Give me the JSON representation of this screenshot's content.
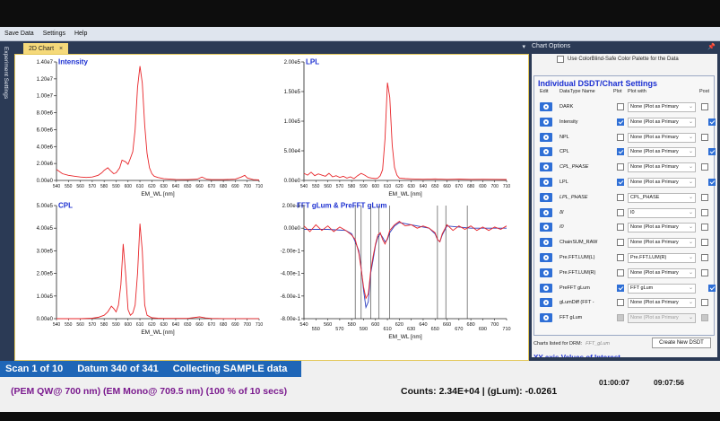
{
  "menu": [
    "Save Data",
    "Settings",
    "Help"
  ],
  "left_strip_label": "Experiment Settings",
  "tab": {
    "label": "2D Chart",
    "close": "×",
    "dropdown": "▾"
  },
  "right_panel": {
    "title": "Chart Options",
    "pin": "📌",
    "palette_label": "Use ColorBlind-Safe Color Palette for the Data",
    "section_title": "Individual DSDT/Chart Settings",
    "columns": [
      "Edit",
      "DataType Name",
      "Plot",
      "Plot with",
      "Post"
    ],
    "rows": [
      {
        "name": "DARK",
        "italic": false,
        "plot": false,
        "plot_with": "None (Plot as Primary",
        "disabled_select": false,
        "post": false
      },
      {
        "name": "Intensity",
        "italic": false,
        "plot": true,
        "plot_with": "None (Plot as Primary",
        "disabled_select": false,
        "post": true
      },
      {
        "name": "NPL",
        "italic": false,
        "plot": false,
        "plot_with": "None (Plot as Primary",
        "disabled_select": false,
        "post": false
      },
      {
        "name": "CPL",
        "italic": false,
        "plot": true,
        "plot_with": "None (Plot as Primary",
        "disabled_select": false,
        "post": true
      },
      {
        "name": "CPL_PHASE",
        "italic": true,
        "plot": false,
        "plot_with": "None (Plot as Primary",
        "disabled_select": false,
        "post": false
      },
      {
        "name": "LPL",
        "italic": false,
        "plot": true,
        "plot_with": "None (Plot as Primary",
        "disabled_select": false,
        "post": true
      },
      {
        "name": "LPL_PHASE",
        "italic": true,
        "plot": false,
        "plot_with": "CPL_PHASE",
        "disabled_select": false,
        "post": false
      },
      {
        "name": "δI",
        "italic": true,
        "plot": false,
        "plot_with": "I0",
        "disabled_select": false,
        "post": false
      },
      {
        "name": "I0",
        "italic": true,
        "plot": false,
        "plot_with": "None (Plot as Primary",
        "disabled_select": false,
        "post": false
      },
      {
        "name": "ChainSUM_RAW",
        "italic": false,
        "plot": false,
        "plot_with": "None (Plot as Primary",
        "disabled_select": false,
        "post": false
      },
      {
        "name": "Pre.FFT.LUM(L)",
        "italic": false,
        "plot": false,
        "plot_with": "Pre.FFT.LUM(R)",
        "disabled_select": false,
        "post": false
      },
      {
        "name": "Pre.FFT.LUM(R)",
        "italic": false,
        "plot": false,
        "plot_with": "None (Plot as Primary",
        "disabled_select": false,
        "post": false
      },
      {
        "name": "PreFFT gLum",
        "italic": false,
        "plot": true,
        "plot_with": "FFT gLum",
        "disabled_select": false,
        "post": true
      },
      {
        "name": "gLumDiff (FFT -",
        "italic": false,
        "plot": false,
        "plot_with": "None (Plot as Primary",
        "disabled_select": false,
        "post": false
      },
      {
        "name": "FFT gLum",
        "italic": false,
        "plot": "disabled",
        "plot_with": "None (Plot as Primary",
        "disabled_select": true,
        "post": "disabled"
      }
    ],
    "drm_label": "Charts listed for DRM:",
    "drm_value": "FFT_gLum",
    "new_button": "Create New DSDT",
    "next_section": "XY-axis Values of Interest"
  },
  "status": {
    "scan": "Scan 1 of 10",
    "datum": "Datum 340 of 341",
    "collecting": "Collecting SAMPLE data",
    "pem": "(PEM QW@ 700 nm) (EM Mono@ 709.5 nm) (100 % of 10 secs)",
    "counts": "Counts: 2.34E+04 | (gLum): -0.0261",
    "time_elapsed": "01:00:07",
    "time_clock": "09:07:56"
  },
  "chart_data": [
    {
      "type": "line",
      "title": "Intensity",
      "xlabel": "EM_WL [nm]",
      "ylabel": "",
      "xlim": [
        540,
        710
      ],
      "ylim": [
        0,
        14000000.0
      ],
      "yticks": [
        "0.00e0",
        "2.00e6",
        "4.00e6",
        "6.00e6",
        "8.00e6",
        "1.00e7",
        "1.20e7",
        "1.40e7"
      ],
      "xticks": [
        "540",
        "550",
        "560",
        "570",
        "580",
        "590",
        "600",
        "610",
        "620",
        "630",
        "640",
        "650",
        "660",
        "670",
        "680",
        "690",
        "700",
        "710"
      ],
      "series": [
        {
          "color": "#e8262a",
          "x": [
            540,
            545,
            550,
            555,
            560,
            565,
            570,
            575,
            578,
            580,
            583,
            585,
            588,
            590,
            593,
            595,
            598,
            600,
            602,
            604,
            606,
            608,
            610,
            612,
            614,
            616,
            618,
            620,
            622,
            625,
            630,
            640,
            650,
            658,
            662,
            666,
            670,
            680,
            690,
            695,
            698,
            700,
            705,
            710
          ],
          "y": [
            1300000.0,
            800000.0,
            600000.0,
            500000.0,
            400000.0,
            350000.0,
            400000.0,
            600000.0,
            900000.0,
            1200000.0,
            1500000.0,
            1200000.0,
            800000.0,
            900000.0,
            1500000.0,
            2400000.0,
            2200000.0,
            1900000.0,
            2600000.0,
            3400000.0,
            6000000.0,
            11000000.0,
            13500000.0,
            11500000.0,
            6500000.0,
            3200000.0,
            1500000.0,
            800000.0,
            500000.0,
            350000.0,
            200000.0,
            120000.0,
            100000.0,
            150000.0,
            400000.0,
            150000.0,
            100000.0,
            100000.0,
            150000.0,
            400000.0,
            600000.0,
            300000.0,
            100000.0,
            50000.0
          ]
        }
      ]
    },
    {
      "type": "line",
      "title": "LPL",
      "xlabel": "EM_WL [nm]",
      "ylabel": "",
      "xlim": [
        540,
        710
      ],
      "ylim": [
        0,
        200000.0
      ],
      "yticks": [
        "0.00e0",
        "5.00e4",
        "1.00e5",
        "1.50e5",
        "2.00e5"
      ],
      "xticks": [
        "540",
        "550",
        "560",
        "570",
        "580",
        "590",
        "600",
        "610",
        "620",
        "630",
        "640",
        "650",
        "660",
        "670",
        "680",
        "690",
        "700",
        "710"
      ],
      "series": [
        {
          "color": "#e8262a",
          "x": [
            540,
            543,
            546,
            549,
            552,
            555,
            558,
            561,
            564,
            567,
            570,
            573,
            576,
            579,
            582,
            585,
            588,
            591,
            594,
            597,
            600,
            602,
            604,
            606,
            608,
            610,
            612,
            614,
            616,
            618,
            620,
            625,
            630,
            640,
            650,
            660,
            670,
            680,
            690,
            700,
            710
          ],
          "y": [
            12000,
            9000,
            14000,
            8000,
            11000,
            9000,
            7000,
            12000,
            6000,
            8000,
            5000,
            7000,
            4000,
            6000,
            3000,
            8000,
            12000,
            9000,
            5000,
            4000,
            3000,
            4000,
            8000,
            18000,
            70000,
            165000,
            140000,
            60000,
            22000,
            9000,
            4000,
            3000,
            2500,
            2000,
            2500,
            1800,
            2200,
            1800,
            2000,
            1800,
            1500
          ]
        }
      ]
    },
    {
      "type": "line",
      "title": "CPL",
      "xlabel": "EM_WL [nm]",
      "ylabel": "",
      "xlim": [
        540,
        710
      ],
      "ylim": [
        0,
        500000.0
      ],
      "yticks": [
        "0.00e0",
        "1.00e5",
        "2.00e5",
        "3.00e5",
        "4.00e5",
        "5.00e5"
      ],
      "xticks": [
        "540",
        "550",
        "560",
        "570",
        "580",
        "590",
        "600",
        "610",
        "620",
        "630",
        "640",
        "650",
        "660",
        "670",
        "680",
        "690",
        "700",
        "710"
      ],
      "series": [
        {
          "color": "#e8262a",
          "x": [
            540,
            550,
            560,
            570,
            575,
            580,
            583,
            586,
            588,
            590,
            592,
            594,
            596,
            598,
            600,
            602,
            604,
            606,
            608,
            610,
            612,
            614,
            616,
            620,
            625,
            630,
            640,
            650,
            660,
            665,
            670,
            680,
            690,
            700,
            710
          ],
          "y": [
            0,
            0,
            0,
            2000,
            6000,
            15000,
            30000,
            55000,
            45000,
            30000,
            60000,
            150000,
            330000,
            200000,
            40000,
            15000,
            25000,
            60000,
            200000,
            420000,
            300000,
            60000,
            15000,
            4000,
            2000,
            1000,
            1000,
            1000,
            8000,
            3000,
            1000,
            500,
            500,
            300,
            200
          ]
        }
      ]
    },
    {
      "type": "line",
      "title": "FFT gLum & PreFFT gLum",
      "xlabel": "EM_WL [nm]",
      "ylabel": "",
      "xlim": [
        540,
        710
      ],
      "ylim": [
        -0.8,
        0.2
      ],
      "yticks": [
        "-8.00e-1",
        "-6.00e-1",
        "-4.00e-1",
        "-2.00e-1",
        "0.00e0",
        "2.00e-1"
      ],
      "xticks": [
        "540",
        "550",
        "560",
        "570",
        "580",
        "590",
        "600",
        "610",
        "620",
        "630",
        "640",
        "650",
        "660",
        "670",
        "680",
        "690",
        "700",
        "710"
      ],
      "vertical_markers": [
        583,
        588,
        596,
        603,
        612,
        652,
        659,
        677
      ],
      "series": [
        {
          "name": "FFT gLum",
          "color": "#2e3fbf",
          "x": [
            540,
            560,
            575,
            580,
            583,
            586,
            588,
            590,
            592,
            594,
            596,
            598,
            600,
            602,
            604,
            606,
            608,
            610,
            612,
            616,
            620,
            630,
            640,
            645,
            650,
            652,
            654,
            656,
            660,
            670,
            680,
            690,
            700,
            710
          ],
          "y": [
            -0.01,
            -0.01,
            -0.02,
            -0.05,
            -0.12,
            -0.2,
            -0.35,
            -0.55,
            -0.7,
            -0.65,
            -0.4,
            -0.28,
            -0.15,
            -0.08,
            -0.05,
            -0.08,
            -0.12,
            -0.1,
            -0.04,
            0.02,
            0.05,
            0.03,
            0.01,
            0.0,
            -0.05,
            -0.1,
            -0.12,
            -0.06,
            0.02,
            0.01,
            0.0,
            0.0,
            0.0,
            0.0
          ]
        },
        {
          "name": "PreFFT gLum",
          "color": "#e8262a",
          "x": [
            540,
            545,
            550,
            555,
            560,
            565,
            570,
            575,
            580,
            583,
            586,
            588,
            590,
            592,
            594,
            596,
            598,
            600,
            602,
            604,
            606,
            608,
            610,
            612,
            616,
            620,
            625,
            630,
            635,
            640,
            645,
            650,
            652,
            654,
            656,
            660,
            665,
            670,
            675,
            680,
            685,
            690,
            695,
            700,
            705,
            710
          ],
          "y": [
            0.02,
            -0.03,
            0.03,
            -0.02,
            0.02,
            -0.03,
            0.01,
            -0.02,
            -0.06,
            -0.1,
            -0.22,
            -0.36,
            -0.52,
            -0.62,
            -0.58,
            -0.38,
            -0.25,
            -0.14,
            -0.06,
            -0.04,
            -0.1,
            -0.14,
            -0.09,
            -0.02,
            0.03,
            0.06,
            0.02,
            0.03,
            0.0,
            0.02,
            0.0,
            -0.04,
            -0.1,
            -0.12,
            -0.05,
            0.03,
            -0.02,
            0.02,
            -0.01,
            0.02,
            -0.02,
            0.01,
            -0.02,
            0.01,
            -0.01,
            0.02
          ]
        }
      ]
    }
  ]
}
